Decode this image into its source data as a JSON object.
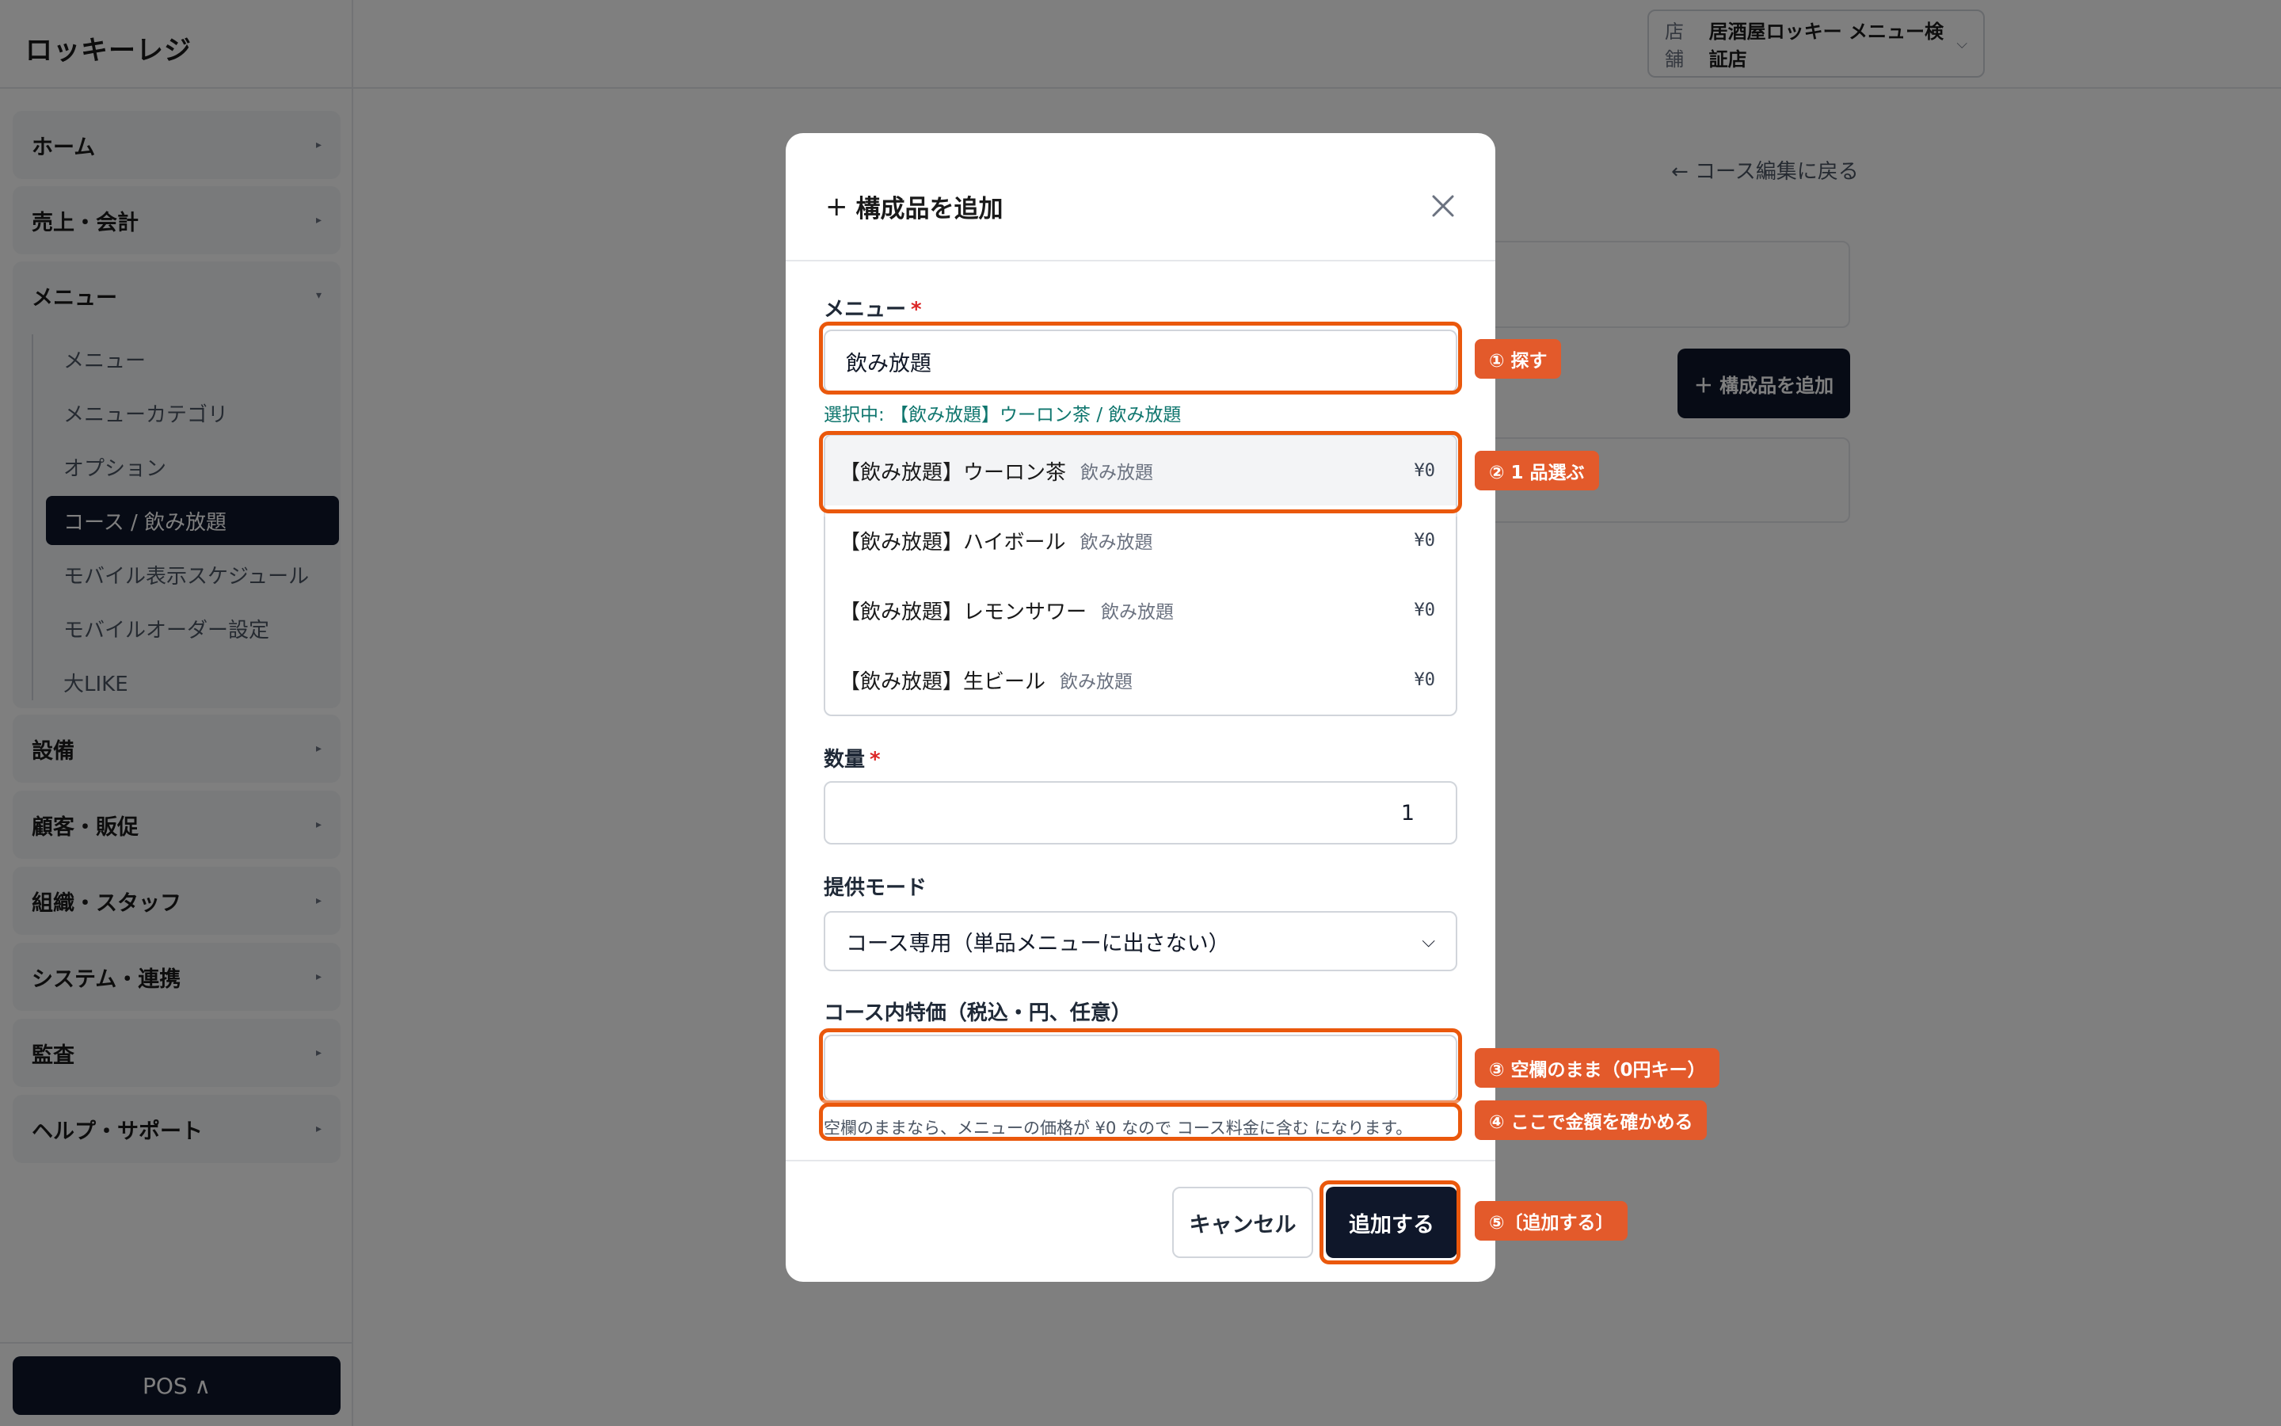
{
  "app": {
    "title": "ロッキーレジ"
  },
  "header": {
    "store_label": "店舗",
    "store_name": "居酒屋ロッキー メニュー検証店",
    "back_link": "← コース編集に戻る",
    "add_component_button": "＋ 構成品を追加"
  },
  "sidebar": {
    "groups": [
      {
        "label": "ホーム",
        "arrow": "▸"
      },
      {
        "label": "売上・会計",
        "arrow": "▸"
      },
      {
        "label": "メニュー",
        "arrow": "▾"
      },
      {
        "label": "設備",
        "arrow": "▸"
      },
      {
        "label": "顧客・販促",
        "arrow": "▸"
      },
      {
        "label": "組織・スタッフ",
        "arrow": "▸"
      },
      {
        "label": "システム・連携",
        "arrow": "▸"
      },
      {
        "label": "監査",
        "arrow": "▸"
      },
      {
        "label": "ヘルプ・サポート",
        "arrow": "▸"
      }
    ],
    "menu_subitems": [
      {
        "label": "メニュー"
      },
      {
        "label": "メニューカテゴリ"
      },
      {
        "label": "オプション"
      },
      {
        "label": "コース / 飲み放題",
        "active": true
      },
      {
        "label": "モバイル表示スケジュール"
      },
      {
        "label": "モバイルオーダー設定"
      },
      {
        "label": "大LIKE"
      }
    ],
    "pos_button": "POS ∧"
  },
  "modal": {
    "title": "構成品を追加",
    "title_icon": "plus-icon",
    "menu_label": "メニュー",
    "required_mark": "*",
    "search_value": "飲み放題",
    "selected_note": "選択中: 【飲み放題】ウーロン茶 / 飲み放題",
    "results": [
      {
        "name": "【飲み放題】ウーロン茶",
        "category": "飲み放題",
        "price": "¥0"
      },
      {
        "name": "【飲み放題】ハイボール",
        "category": "飲み放題",
        "price": "¥0"
      },
      {
        "name": "【飲み放題】レモンサワー",
        "category": "飲み放題",
        "price": "¥0"
      },
      {
        "name": "【飲み放題】生ビール",
        "category": "飲み放題",
        "price": "¥0"
      }
    ],
    "quantity_label": "数量",
    "quantity_value": "1",
    "mode_label": "提供モード",
    "mode_value": "コース専用（単品メニューに出さない）",
    "special_price_label": "コース内特価（税込・円、任意）",
    "special_price_value": "",
    "hint": "空欄のままなら、メニューの価格が ¥0 なので コース料金に含む になります。",
    "cancel_button": "キャンセル",
    "add_button": "追加する"
  },
  "annotations": [
    {
      "label": "① 探す"
    },
    {
      "label": "② 1 品選ぶ"
    },
    {
      "label": "③ 空欄のまま（0円キー）"
    },
    {
      "label": "④ ここで金額を確かめる"
    },
    {
      "label": "⑤〔追加する〕"
    }
  ],
  "colors": {
    "primary": "#0f172a",
    "accent": "#ea580c",
    "badge": "#e35a2b",
    "required": "#dc2626",
    "selected_note": "#0f766e",
    "overlay": "rgba(0,0,0,0.5)"
  }
}
